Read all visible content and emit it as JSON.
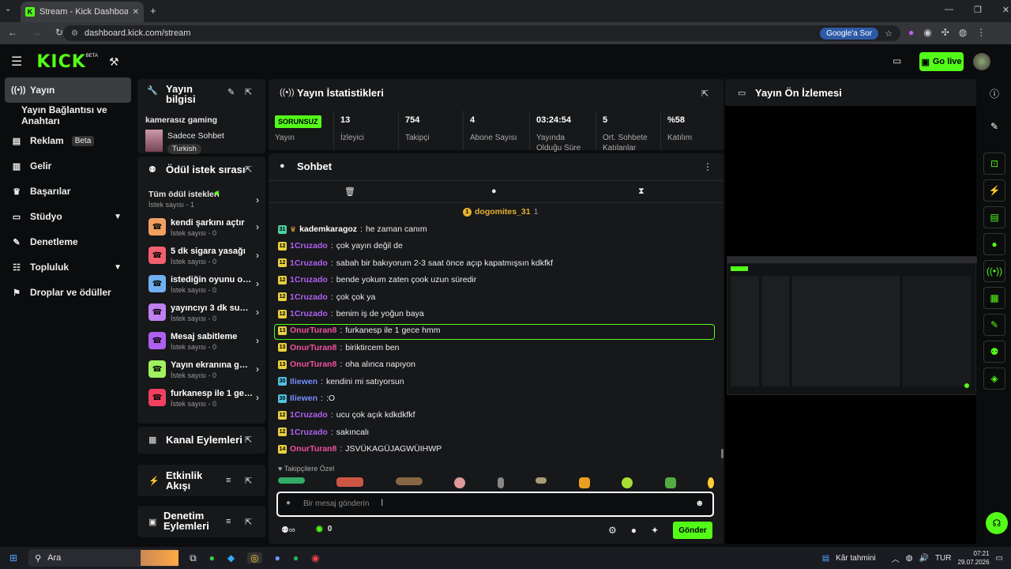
{
  "browser": {
    "tab_title": "Stream - Kick Dashboard",
    "url": "dashboard.kick.com/stream",
    "google_btn": "Google'a Sor"
  },
  "header": {
    "logo": "KICK",
    "beta": "BETA",
    "go_live": "Go live"
  },
  "sidebar": {
    "items": [
      {
        "label": "Yayın"
      },
      {
        "label": "Yayın Bağlantısı ve Anahtarı"
      },
      {
        "label": "Reklam",
        "badge": "Beta"
      },
      {
        "label": "Gelir"
      },
      {
        "label": "Başarılar"
      },
      {
        "label": "Stüdyo"
      },
      {
        "label": "Denetleme"
      },
      {
        "label": "Topluluk"
      },
      {
        "label": "Droplar ve ödüller"
      }
    ]
  },
  "stream_info": {
    "title": "Yayın bilgisi",
    "channel": "kamerasız gaming",
    "category": "Sadece Sohbet",
    "language": "Turkish"
  },
  "rewards": {
    "title": "Ödül istek sırası",
    "all_label": "Tüm ödül istekleri",
    "all_count": "İstek sayısı - 1",
    "items": [
      {
        "name": "kendi şarkını açtır",
        "count": "İstek sayısı - 0",
        "color": "#f0a060"
      },
      {
        "name": "5 dk sigara yasağı",
        "count": "İstek sayısı - 0",
        "color": "#f06070"
      },
      {
        "name": "istediğin oyunu oyna...",
        "count": "İstek sayısı - 0",
        "color": "#70b0f0"
      },
      {
        "name": "yayıncıyı 3 dk sustur",
        "count": "İstek sayısı - 0",
        "color": "#c080f0"
      },
      {
        "name": "Mesaj sabitleme",
        "count": "İstek sayısı - 0",
        "color": "#b060f0"
      },
      {
        "name": "Yayın ekranına görs...",
        "count": "İstek sayısı - 0",
        "color": "#a0f060"
      },
      {
        "name": "furkanesp ile 1 gece",
        "count": "İstek sayısı - 0",
        "color": "#f04060"
      }
    ]
  },
  "channel_actions": {
    "title": "Kanal Eylemleri"
  },
  "activity": {
    "title": "Etkinlik Akışı"
  },
  "mod_actions": {
    "title": "Denetim Eylemleri"
  },
  "stats": {
    "title": "Yayın İstatistikleri",
    "status": "SORUNSUZ",
    "status_label": "Yayın",
    "cells": [
      {
        "value": "13",
        "label": "İzleyici"
      },
      {
        "value": "754",
        "label": "Takipçi"
      },
      {
        "value": "4",
        "label": "Abone Sayısı"
      },
      {
        "value": "03:24:54",
        "label": "Yayında Olduğu Süre"
      },
      {
        "value": "5",
        "label": "Ort. Sohbete Katılanlar"
      },
      {
        "value": "%58",
        "label": "Katılım"
      }
    ]
  },
  "chat": {
    "title": "Sohbet",
    "pinned_user": "dogomites_31",
    "pinned_count": "1",
    "followers_only": "Takipçilere Özel",
    "placeholder": "Bir mesaj gönderin",
    "send": "Gönder",
    "count": "0",
    "messages": [
      {
        "badge": "31",
        "bcolor": "#4dd0a0",
        "user": "kademkaragoz",
        "ucolor": "#ffffff",
        "text": "he zaman canım"
      },
      {
        "badge": "12",
        "bcolor": "#e8d040",
        "user": "1Cruzado",
        "ucolor": "#b060f0",
        "text": "çok yayın değil de"
      },
      {
        "badge": "12",
        "bcolor": "#e8d040",
        "user": "1Cruzado",
        "ucolor": "#b060f0",
        "text": "sabah bir bakıyorum 2-3 saat önce açıp kapatmışsın kdkfkf"
      },
      {
        "badge": "12",
        "bcolor": "#e8d040",
        "user": "1Cruzado",
        "ucolor": "#b060f0",
        "text": "bende yokum zaten çook uzun süredir"
      },
      {
        "badge": "12",
        "bcolor": "#e8d040",
        "user": "1Cruzado",
        "ucolor": "#b060f0",
        "text": "çok çok ya"
      },
      {
        "badge": "12",
        "bcolor": "#e8d040",
        "user": "1Cruzado",
        "ucolor": "#b060f0",
        "text": "benim iş de yoğun baya"
      },
      {
        "badge": "13",
        "bcolor": "#e8d040",
        "user": "OnurTuran8",
        "ucolor": "#f050a0",
        "text": "furkanesp ile 1 gece hmm"
      },
      {
        "badge": "13",
        "bcolor": "#e8d040",
        "user": "OnurTuran8",
        "ucolor": "#f050a0",
        "text": "biriktircem ben"
      },
      {
        "badge": "13",
        "bcolor": "#e8d040",
        "user": "OnurTuran8",
        "ucolor": "#f050a0",
        "text": "oha alınca napıyon"
      },
      {
        "badge": "30",
        "bcolor": "#50c0e0",
        "user": "Iliewen",
        "ucolor": "#7090ff",
        "text": "kendini mi satıyorsun"
      },
      {
        "badge": "30",
        "bcolor": "#50c0e0",
        "user": "Iliewen",
        "ucolor": "#7090ff",
        "text": ":O"
      },
      {
        "badge": "12",
        "bcolor": "#e8d040",
        "user": "1Cruzado",
        "ucolor": "#b060f0",
        "text": "ucu çok açık kdkdkfkf"
      },
      {
        "badge": "12",
        "bcolor": "#e8d040",
        "user": "1Cruzado",
        "ucolor": "#b060f0",
        "text": "sakıncalı"
      },
      {
        "badge": "14",
        "bcolor": "#e8d040",
        "user": "OnurTuran8",
        "ucolor": "#f050a0",
        "text": "JSVÜKAGÜJAGWÜIHWP"
      }
    ]
  },
  "preview": {
    "title": "Yayın Ön İzlemesi"
  },
  "taskbar": {
    "search": "Ara",
    "weather": "Kâr tahmini",
    "lang": "TUR",
    "time": "07:21",
    "date": "29.07.2026"
  }
}
